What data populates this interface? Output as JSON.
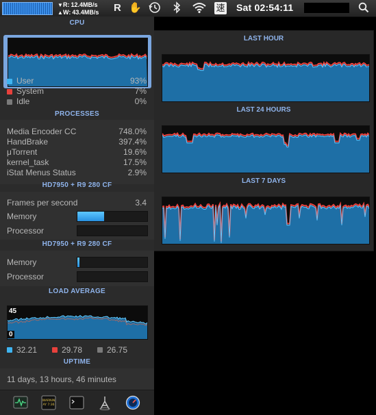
{
  "menubar": {
    "net_read_label": "R:",
    "net_read": "12.4MB/s",
    "net_write_label": "W:",
    "net_write": "43.4MB/s",
    "clock": "Sat 02:54:11",
    "input_char": "速",
    "r_icon": "R"
  },
  "cpu": {
    "title": "CPU",
    "rows": [
      {
        "label": "User",
        "value": "93%",
        "color": "#3fb4f0"
      },
      {
        "label": "System",
        "value": "7%",
        "color": "#e8413c"
      },
      {
        "label": "Idle",
        "value": "0%",
        "color": "#7a7a7a"
      }
    ]
  },
  "processes": {
    "title": "PROCESSES",
    "rows": [
      {
        "name": "Media Encoder CC",
        "value": "748.0%"
      },
      {
        "name": "HandBrake",
        "value": "397.4%"
      },
      {
        "name": "μTorrent",
        "value": "19.6%"
      },
      {
        "name": "kernel_task",
        "value": "17.5%"
      },
      {
        "name": "iStat Menus Status",
        "value": "2.9%"
      }
    ]
  },
  "gpu1": {
    "title": "HD7950 + R9 280 CF",
    "fps_label": "Frames per second",
    "fps_value": "3.4",
    "memory_label": "Memory",
    "memory_fraction": 0.38,
    "processor_label": "Processor",
    "processor_fraction": 0.0
  },
  "gpu2": {
    "title": "HD7950 + R9 280 CF",
    "memory_label": "Memory",
    "memory_fraction": 0.03,
    "processor_label": "Processor",
    "processor_fraction": 0.0
  },
  "load": {
    "title": "LOAD AVERAGE",
    "max_label": "45",
    "min_label": "0",
    "legend": [
      {
        "value": "32.21",
        "color": "#3fb4f0"
      },
      {
        "value": "29.78",
        "color": "#e8413c"
      },
      {
        "value": "26.75",
        "color": "#7a7a7a"
      }
    ]
  },
  "uptime": {
    "title": "UPTIME",
    "value": "11 days, 13 hours, 46 minutes"
  },
  "history": {
    "last_hour": "LAST HOUR",
    "last_24": "LAST 24 HOURS",
    "last_7": "LAST 7 DAYS"
  },
  "toolbar": {
    "icons": [
      "activity-monitor-icon",
      "console-log-icon",
      "terminal-icon",
      "network-utility-icon",
      "istat-settings-icon"
    ],
    "console_label": "WARNIN\nAY 7:36"
  },
  "colors": {
    "user": "#3fb4f0",
    "system": "#e8413c",
    "graph_fill": "#1e6fa6",
    "accent_title": "#8fb4ec"
  }
}
